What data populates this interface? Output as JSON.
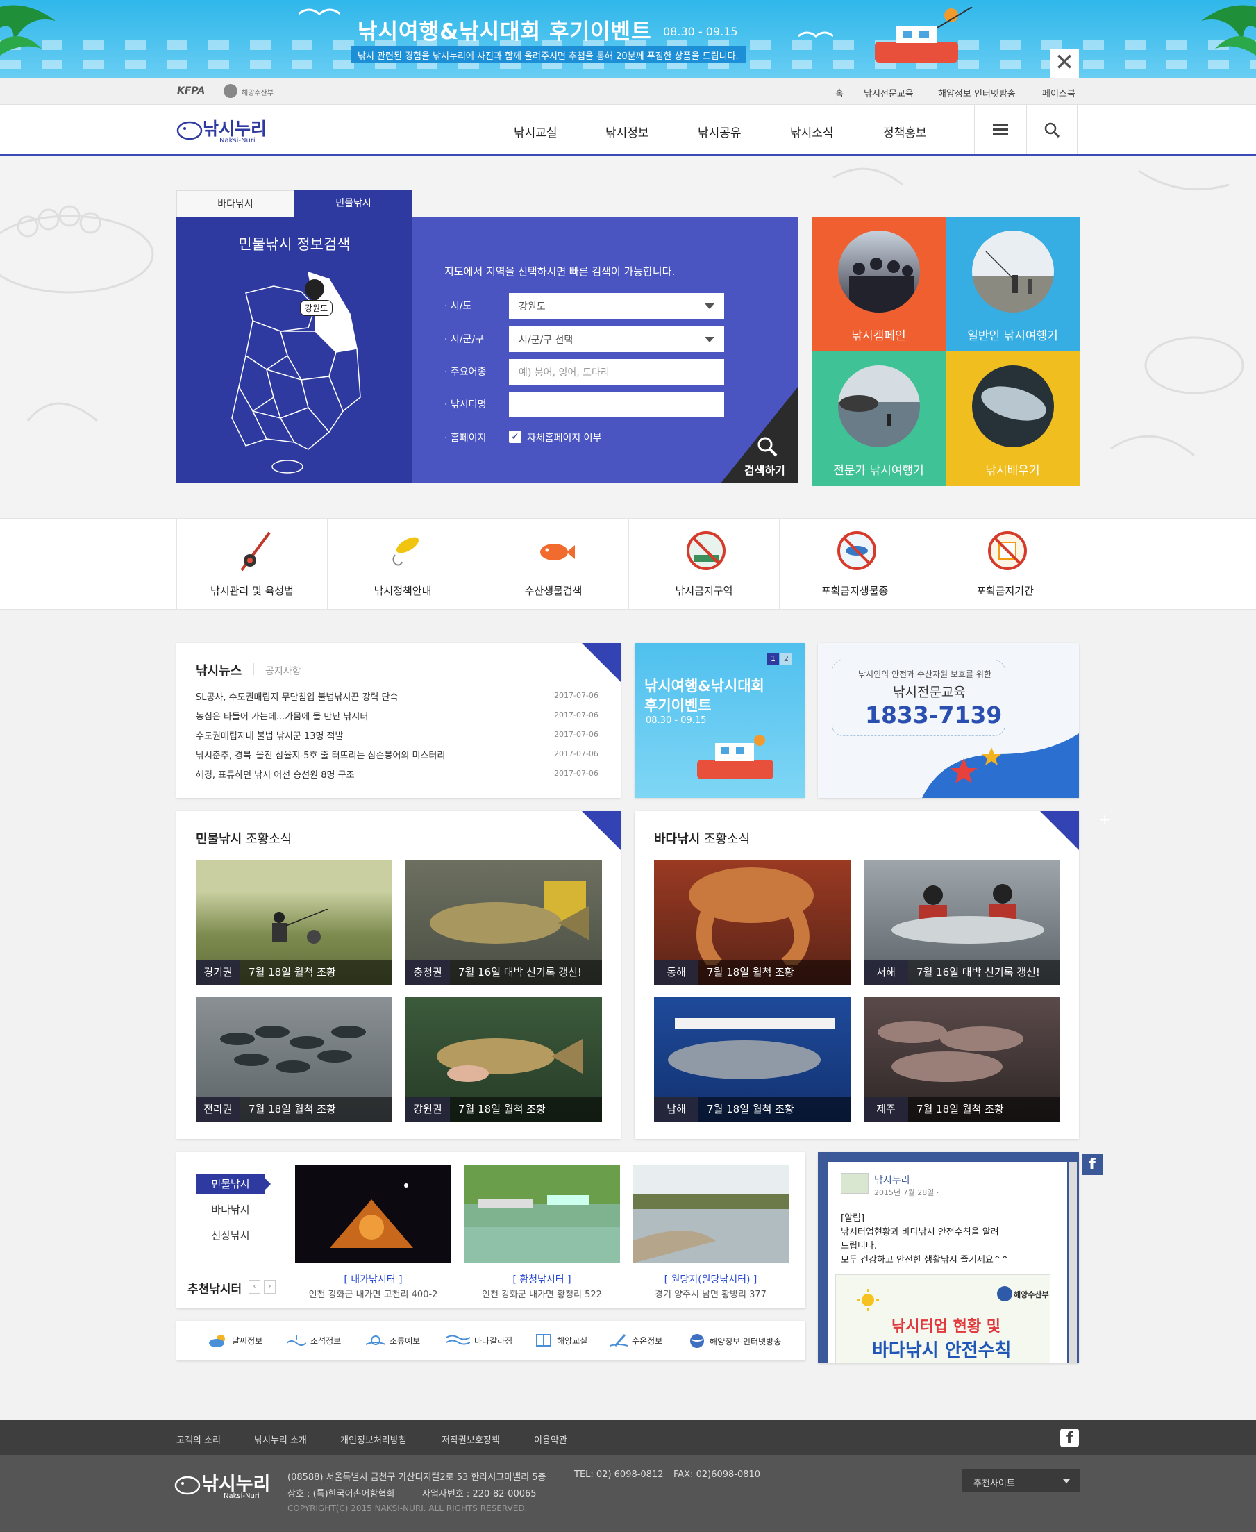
{
  "banner": {
    "title": "낚시여행&낚시대회 후기이벤트",
    "date": "08.30 - 09.15",
    "desc": "낚시 관련된 경험을 낚시누리에 사진과 함께 올려주시면 추첨을 통해 20분께 푸짐한 상품을 드립니다.",
    "close": "✕"
  },
  "utility": {
    "logo1": "KFPA",
    "logo2": "해양수산부",
    "links": [
      "홈",
      "낚시전문교육",
      "해양정보 인터넷방송",
      "페이스북"
    ]
  },
  "gnb": {
    "logo_main": "낚시누리",
    "logo_sub": "Naksi-Nuri",
    "menu": [
      "낚시교실",
      "낚시정보",
      "낚시공유",
      "낚시소식",
      "정책홍보"
    ]
  },
  "search": {
    "tabs": [
      "바다낚시",
      "민물낚시"
    ],
    "map_title": "민물낚시 정보검색",
    "map_marker": "강원도",
    "intro": "지도에서 지역을 선택하시면 빠른 검색이 가능합니다.",
    "fields": [
      {
        "label": "· 시/도",
        "value": "강원도"
      },
      {
        "label": "· 시/군/구",
        "value": "시/군/구 선택"
      },
      {
        "label": "· 주요어종",
        "placeholder": "예) 붕어, 잉어, 도다리"
      },
      {
        "label": "· 낚시터명",
        "value": ""
      },
      {
        "label": "· 홈페이지",
        "checkbox_label": "자체홈페이지 여부"
      }
    ],
    "submit": "검색하기"
  },
  "tiles": [
    {
      "label": "낚시캠페인",
      "color": "#ef5f2f"
    },
    {
      "label": "일반인 낚시여행기",
      "color": "#36aee3"
    },
    {
      "label": "전문가 낚시여행기",
      "color": "#3fc396"
    },
    {
      "label": "낚시배우기",
      "color": "#f0be1f"
    }
  ],
  "quick": [
    {
      "label": "낚시관리 및 육성법",
      "icon": "fishing-rod-icon"
    },
    {
      "label": "낚시정책안내",
      "icon": "lure-icon"
    },
    {
      "label": "수산생물검색",
      "icon": "fish-icon"
    },
    {
      "label": "낚시금지구역",
      "icon": "no-fishing-zone-icon"
    },
    {
      "label": "포획금지생물종",
      "icon": "no-catch-species-icon"
    },
    {
      "label": "포획금지기간",
      "icon": "no-catch-period-icon"
    }
  ],
  "news": {
    "tab_active": "낚시뉴스",
    "tab_other": "공지사항",
    "items": [
      {
        "title": "SL공사, 수도권매립지 무단침입 불법낚시꾼 강력 단속",
        "date": "2017-07-06"
      },
      {
        "title": "농심은 타들어 가는데...가뭄에 물 만난 낚시터",
        "date": "2017-07-06"
      },
      {
        "title": "수도권매립지내 불법 낚시꾼 13명 적발",
        "date": "2017-07-06"
      },
      {
        "title": "낚시춘추, 경북_울진 삼율지-5호 줄 터뜨리는 삼손붕어의 미스터리",
        "date": "2017-07-06"
      },
      {
        "title": "해경, 표류하던 낚시 어선 승선원 8명 구조",
        "date": "2017-07-06"
      }
    ]
  },
  "promo": {
    "title_line1": "낚시여행&낚시대회",
    "title_line2": "후기이벤트",
    "date": "08.30 - 09.15",
    "pages": [
      "1",
      "2"
    ]
  },
  "edu": {
    "small": "낚시인의 안전과 수산자원 보호를 위한",
    "title": "낚시전문교육",
    "phone": "1833-7139"
  },
  "fresh": {
    "title_bold": "민물낚시",
    "title_rest": "조황소식",
    "items": [
      {
        "region": "경기권",
        "text": "7월 18일 월척 조황"
      },
      {
        "region": "충청권",
        "text": "7월 16일 대박 신기록 갱신!"
      },
      {
        "region": "전라권",
        "text": "7월 18일 월척 조황"
      },
      {
        "region": "강원권",
        "text": "7월 18일 월척 조황"
      }
    ]
  },
  "sea": {
    "title_bold": "바다낚시",
    "title_rest": "조황소식",
    "items": [
      {
        "region": "동해",
        "text": "7월 18일 월척 조황"
      },
      {
        "region": "서해",
        "text": "7월 16일 대박 신기록 갱신!"
      },
      {
        "region": "남해",
        "text": "7월 18일 월척 조황"
      },
      {
        "region": "제주",
        "text": "7월 18일 월척 조황"
      }
    ]
  },
  "recommend": {
    "tabs": [
      "민물낚시",
      "바다낚시",
      "선상낚시"
    ],
    "title": "추천낚시터",
    "items": [
      {
        "name": "[ 내가낚시터 ]",
        "addr": "인천 강화군 내가면 고천리 400-2"
      },
      {
        "name": "[ 황청낚시터 ]",
        "addr": "인천 강화군 내가면 황청리 522"
      },
      {
        "name": "[ 원당지(원당낚시터) ]",
        "addr": "경기 양주시 남면 황방리 377"
      }
    ]
  },
  "tools": [
    "날씨정보",
    "조석정보",
    "조류예보",
    "바다갈라짐",
    "해양교실",
    "수온정보",
    "해양정보 인터넷방송"
  ],
  "facebook": {
    "name": "낚시누리",
    "date": "2015년 7월 28일 ·",
    "post_l1": "[알림]",
    "post_l2": "낚시터업현황과 바다낚시 안전수칙을 알려",
    "post_l3": "드립니다.",
    "post_l4": "모두 건강하고 안전한 생활낚시 즐기세요^^",
    "img_brand": "해양수산부",
    "img_l1": "낚시터업 현황 및",
    "img_l2": "바다낚시 안전수칙"
  },
  "footer": {
    "links": [
      "고객의 소리",
      "낚시누리 소개",
      "개인정보처리방침",
      "저작권보호정책",
      "이용약관"
    ],
    "address": "(08588) 서울특별시 금천구 가산디지털2로 53 한라시그마밸리 5층",
    "tel": "TEL: 02) 6098-0812",
    "fax": "FAX: 02)6098-0810",
    "company": "상호 : (특)한국어촌어항협회",
    "bizno": "사업자번호 : 220-82-00065",
    "copyright": "COPYRIGHT(C) 2015 NAKSI-NURI. ALL RIGHTS RESERVED.",
    "site_select": "추천사이트"
  }
}
